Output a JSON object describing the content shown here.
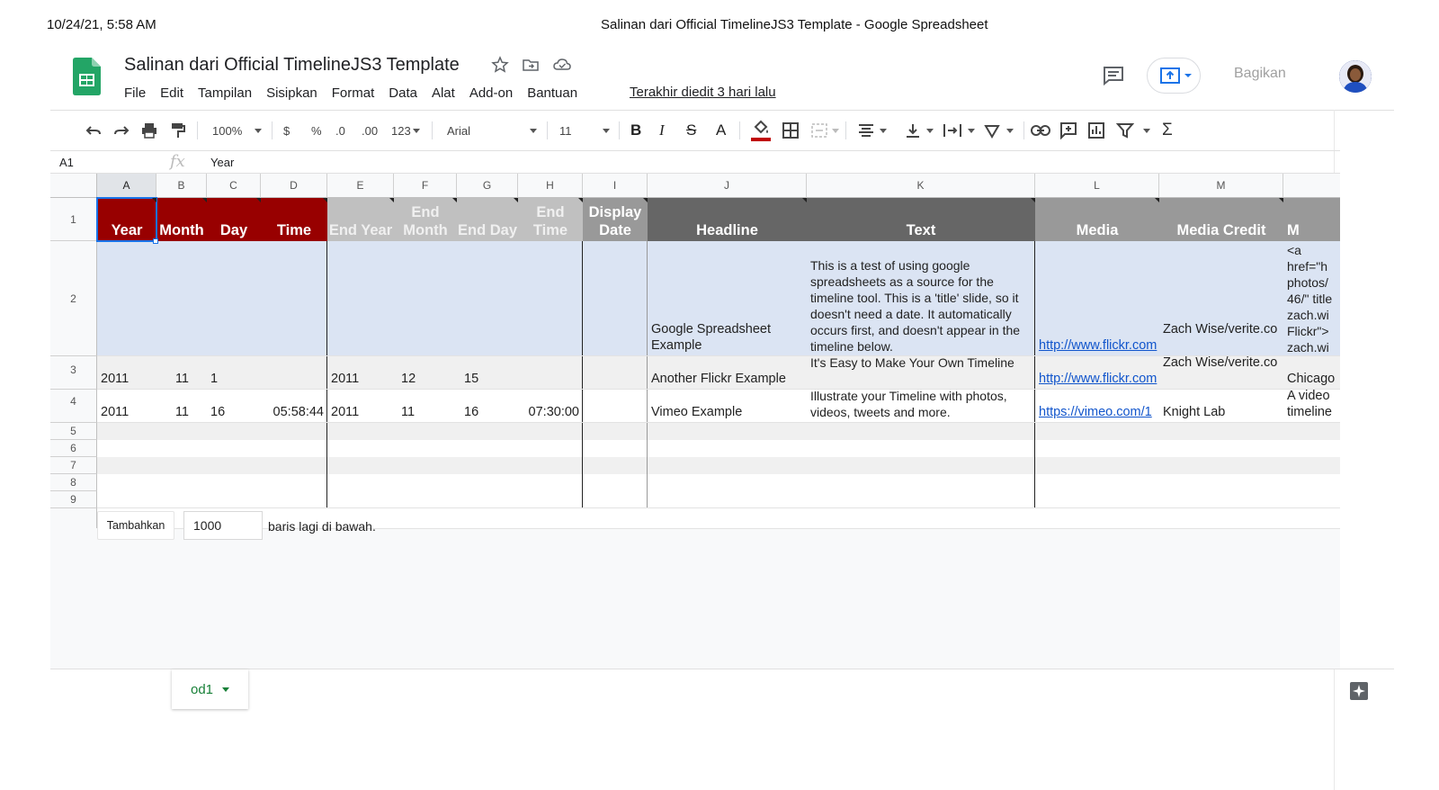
{
  "print_header": {
    "date": "10/24/21, 5:58 AM",
    "page_title": "Salinan dari Official TimelineJS3 Template - Google Spreadsheet"
  },
  "doc": {
    "title": "Salinan dari Official TimelineJS3 Template",
    "last_edit": "Terakhir diedit 3 hari lalu"
  },
  "menu": [
    "File",
    "Edit",
    "Tampilan",
    "Sisipkan",
    "Format",
    "Data",
    "Alat",
    "Add-on",
    "Bantuan"
  ],
  "share_label": "Bagikan",
  "toolbar": {
    "zoom": "100%",
    "currency": "$",
    "percent": "%",
    "dec_less": ".0",
    "dec_more": ".00",
    "more_formats": "123",
    "font": "Arial",
    "font_size": "11"
  },
  "formula_bar": {
    "name_box": "A1",
    "fx": "fx",
    "value": "Year"
  },
  "columns": [
    "A",
    "B",
    "C",
    "D",
    "E",
    "F",
    "G",
    "H",
    "I",
    "J",
    "K",
    "L",
    "M"
  ],
  "row_numbers": [
    "1",
    "2",
    "3",
    "4",
    "5",
    "6",
    "7",
    "8",
    "9"
  ],
  "header_row": [
    "Year",
    "Month",
    "Day",
    "Time",
    "End Year",
    "End Month",
    "End Day",
    "End Time",
    "Display Date",
    "Headline",
    "Text",
    "Media",
    "Media Credit",
    "M"
  ],
  "rows": [
    {
      "headline": "Google Spreadsheet Example",
      "text": "This is a test of using google spreadsheets as a source for the timeline tool. This is a 'title' slide, so it doesn't need a date. It automatically occurs first, and doesn't appear in the timeline below.",
      "media": "http://www.flickr.com",
      "media_credit": "Zach Wise/verite.co",
      "caption": "<a href=\"h photos/ 46/\" title zach.wi Flickr\"> zach.wi"
    },
    {
      "year": "2011",
      "month": "11",
      "day": "1",
      "end_year": "2011",
      "end_month": "12",
      "end_day": "15",
      "headline": "Another Flickr Example",
      "text": "It's Easy to Make Your Own Timeline",
      "media": "http://www.flickr.com",
      "media_credit": "Zach Wise/verite.co",
      "caption": "Chicago"
    },
    {
      "year": "2011",
      "month": "11",
      "day": "16",
      "time": "05:58:44",
      "end_year": "2011",
      "end_month": "11",
      "end_day": "16",
      "end_time": "07:30:00",
      "headline": "Vimeo Example",
      "text": "Illustrate your Timeline with photos, videos, tweets and more.",
      "media": "https://vimeo.com/1",
      "media_credit": "Knight Lab",
      "caption": "A video timeline"
    }
  ],
  "add_rows": {
    "button": "Tambahkan",
    "count": "1000",
    "suffix": "baris lagi di bawah."
  },
  "sheet_tab": "od1",
  "colors": {
    "red_header": "#980000",
    "light_header": "#c0c0c0",
    "dark_header": "#666666",
    "selection_fill": "#dbe4f3",
    "sheets_green": "#188038",
    "link": "#1155cc"
  }
}
